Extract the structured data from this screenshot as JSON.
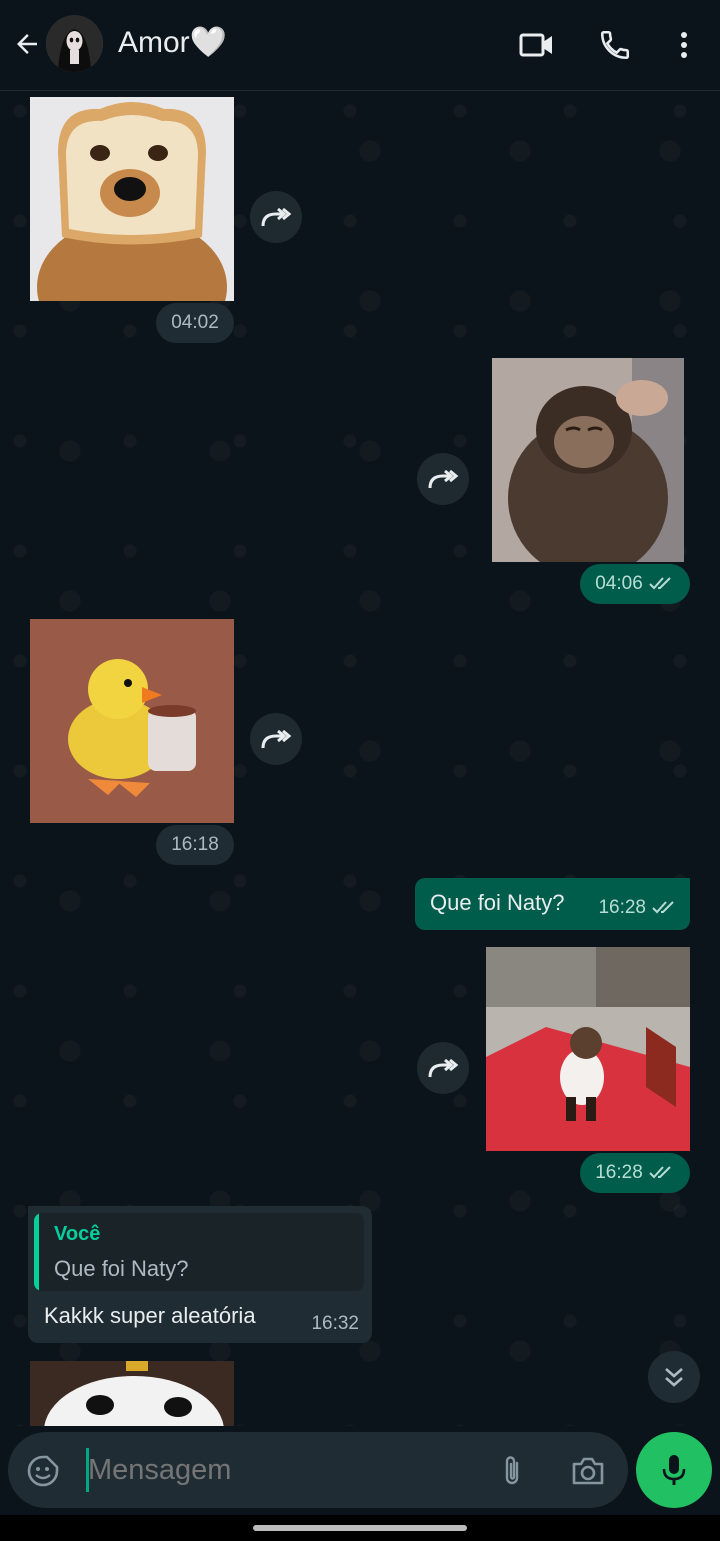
{
  "header": {
    "contact_name": "Amor🤍",
    "icons": [
      "back-arrow-icon",
      "video-call-icon",
      "phone-icon",
      "more-vertical-icon"
    ]
  },
  "messages": [
    {
      "direction": "in",
      "type": "image",
      "content": "dog with bread slice",
      "time": "04:02"
    },
    {
      "direction": "out",
      "type": "image",
      "content": "monkey",
      "time": "04:06",
      "status": "read"
    },
    {
      "direction": "in",
      "type": "image",
      "content": "duck with mug",
      "time": "16:18"
    },
    {
      "direction": "out",
      "type": "text",
      "text": "Que foi Naty?",
      "time": "16:28",
      "status": "read"
    },
    {
      "direction": "out",
      "type": "image",
      "content": "monkey on red carpet",
      "time": "16:28",
      "status": "read"
    },
    {
      "direction": "in",
      "type": "reply",
      "quoted_author": "Você",
      "quoted_text": "Que foi Naty?",
      "text": "Kakkk super aleatória",
      "time": "16:32"
    },
    {
      "direction": "in",
      "type": "image",
      "content": "white dog peeking"
    }
  ],
  "composer": {
    "placeholder": "Mensagem"
  },
  "colors": {
    "background": "#0b141a",
    "incoming_bubble": "#1f2c33",
    "outgoing_bubble": "#005c4b",
    "accent": "#21c063",
    "reply_accent": "#06cf9c"
  }
}
